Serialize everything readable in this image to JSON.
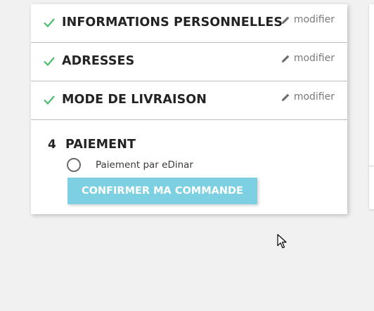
{
  "steps": [
    {
      "title": "INFORMATIONS PERSONNELLES",
      "edit_label": "modifier",
      "status": "completed"
    },
    {
      "title": "ADRESSES",
      "edit_label": "modifier",
      "status": "completed"
    },
    {
      "title": "MODE DE LIVRAISON",
      "edit_label": "modifier",
      "status": "completed"
    }
  ],
  "payment": {
    "number": "4",
    "title": "PAIEMENT",
    "option_label": "Paiement par eDinar",
    "option_selected": false,
    "confirm_label": "CONFIRMER MA COMMANDE"
  },
  "icons": {
    "completed": "check-icon",
    "edit": "pencil-icon",
    "cursor": "mouse-pointer-icon"
  },
  "colors": {
    "check": "#4cbb6c",
    "confirm_button": "#7dd0e2",
    "background": "#f1f1f1"
  }
}
